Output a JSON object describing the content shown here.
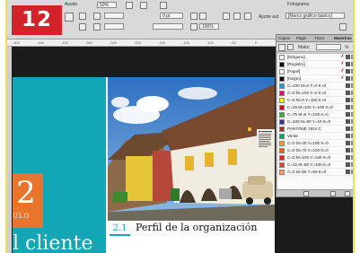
{
  "step_badge": "12",
  "control": {
    "help_label": "Ayuda",
    "zoom_value": "50%",
    "stroke_value": "0 pt",
    "percent_value": "100%",
    "frame_label": "Fotograma",
    "auto_fit_label": "Ajuste aut",
    "style_value": "[Marco gráfico básico]"
  },
  "ruler": {
    "ticks": [
      "-500",
      "-450",
      "-400",
      "-350",
      "-300",
      "-250",
      "-200",
      "-150",
      "-100",
      "-50",
      "0"
    ]
  },
  "document": {
    "chapter_number": "2",
    "chapter_label": "ULO",
    "teal_title": "l cliente",
    "section_number": "2.1",
    "section_title": "Perfil de la organización"
  },
  "swatches_panel": {
    "tabs": [
      "Capas",
      "Págin",
      "Trazo",
      "Muestras"
    ],
    "active_tab": "Muestras",
    "tint_label": "Matiz:",
    "tint_unit": "%",
    "items": [
      {
        "name": "[Ninguno]",
        "color": "#ffffff"
      },
      {
        "name": "[Registro]",
        "color": "#000000"
      },
      {
        "name": "[Papel]",
        "color": "#ffffff"
      },
      {
        "name": "[Negro]",
        "color": "#000000"
      },
      {
        "name": "C=100 M=0 Y=0 K=0",
        "color": "#00a3e0"
      },
      {
        "name": "C=0 M=100 Y=0 K=0",
        "color": "#e4007c"
      },
      {
        "name": "C=0 M=0 Y=100 K=0",
        "color": "#fff200"
      },
      {
        "name": "C=15 M=100 Y=100 K=0",
        "color": "#c8102e"
      },
      {
        "name": "C=75 M=5 Y=100 K=0",
        "color": "#3aaa35"
      },
      {
        "name": "C=100 M=90 Y=10 K=0",
        "color": "#2e3192"
      },
      {
        "name": "PANTONE 7624 C",
        "color": "#b1272a"
      },
      {
        "name": "Verde",
        "color": "#00a651"
      },
      {
        "name": "C=0 M=40 Y=100 K=0",
        "color": "#f7a01c"
      },
      {
        "name": "C=0 M=70 Y=100 K=0",
        "color": "#ef5a24"
      },
      {
        "name": "C=0 M=100 Y=100 K=0",
        "color": "#ed1c24"
      },
      {
        "name": "C=15 M=80 Y=100 K=0",
        "color": "#cd4a25"
      },
      {
        "name": "C=0 M=50 Y=60 K=0",
        "color": "#f49b6c"
      }
    ]
  }
}
